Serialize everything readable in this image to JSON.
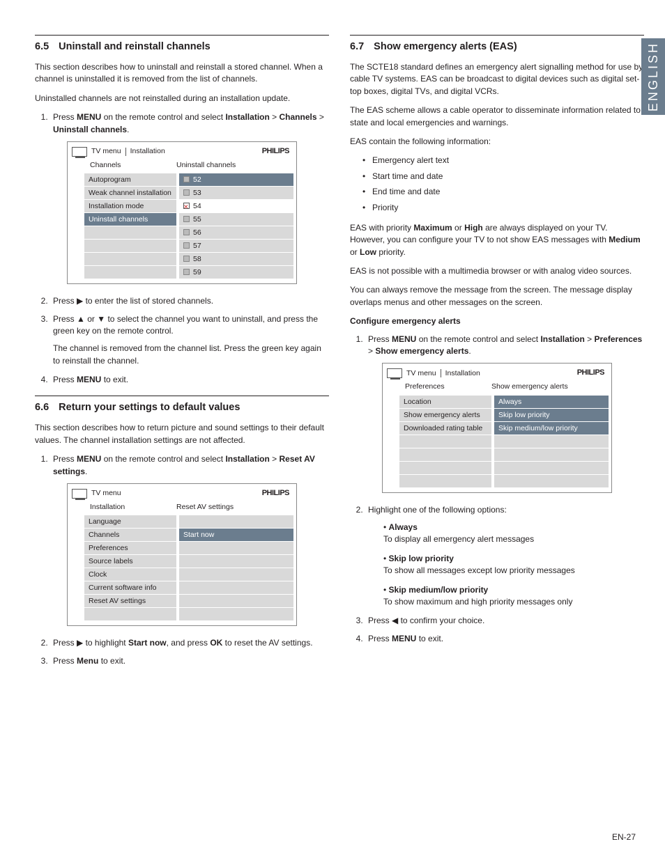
{
  "language_tab": "ENGLISH",
  "page_number": "EN-27",
  "brand": "PHILIPS",
  "left": {
    "s65": {
      "num": "6.5",
      "title": "Uninstall and reinstall channels",
      "p1": "This section describes how to uninstall and reinstall a stored channel. When a channel is uninstalled it is removed from the list of channels.",
      "p2": "Uninstalled channels are not reinstalled during an installation update.",
      "step1a": "Press ",
      "step1b": " on the remote control and select ",
      "step1c": " > ",
      "step1d": " > ",
      "step1e": ".",
      "menu": "MENU",
      "path1": "Installation",
      "path2": "Channels",
      "path3": "Uninstall channels",
      "tv": {
        "crumb1": "TV menu",
        "crumb2": "Installation",
        "sub_left": "Channels",
        "sub_right": "Uninstall channels",
        "left_rows": [
          "Autoprogram",
          "Weak channel installation",
          "Installation mode",
          "Uninstall channels"
        ],
        "left_selected": 3,
        "right_rows": [
          "52",
          "53",
          "54",
          "55",
          "56",
          "57",
          "58",
          "59"
        ],
        "right_selected": 0,
        "unchecked_index": 2
      },
      "step2a": "Press ",
      "step2b": " to enter the list of stored channels.",
      "step3a": "Press ",
      "step3b": " or ",
      "step3c": " to select the channel you want to uninstall, and press the green key on the remote control.",
      "step3_p2": "The channel is removed from the channel list. Press the green key again to reinstall the channel.",
      "step4a": "Press ",
      "step4b": " to exit."
    },
    "s66": {
      "num": "6.6",
      "title": "Return your settings to default values",
      "p1": "This section describes how to return picture and sound settings to their default values.  The channel installation settings are not affected.",
      "step1a": "Press ",
      "step1b": " on the remote control and select ",
      "step1c": " > ",
      "step1d": ".",
      "menu": "MENU",
      "path1": "Installation",
      "path2": "Reset AV settings",
      "tv": {
        "crumb1": "TV menu",
        "sub_left": "Installation",
        "sub_right": "Reset AV settings",
        "left_rows": [
          "Language",
          "Channels",
          "Preferences",
          "Source labels",
          "Clock",
          "Current software info",
          "Reset AV settings",
          ""
        ],
        "right_rows": [
          "",
          "Start now",
          "",
          "",
          "",
          "",
          "",
          ""
        ],
        "right_selected": 1
      },
      "step2a": "Press ",
      "step2b": " to highlight ",
      "step2c": ", and press ",
      "step2d": " to reset the AV settings.",
      "startnow": "Start now",
      "ok": "OK",
      "step3a": "Press ",
      "step3b": " to exit.",
      "menu3": "Menu"
    }
  },
  "right": {
    "s67": {
      "num": "6.7",
      "title": "Show emergency alerts (EAS)",
      "p1": "The SCTE18 standard defines an emergency alert signalling method for use by cable TV systems.  EAS can be broadcast to digital devices such as digital set-top boxes, digital TVs, and digital VCRs.",
      "p2": "The EAS scheme allows a cable operator to disseminate information related to state and local emergencies and warnings.",
      "p3": "EAS contain the following information:",
      "bullets": [
        "Emergency alert text",
        "Start time and date",
        "End time and date",
        "Priority"
      ],
      "p4a": "EAS with priority ",
      "p4b": " or ",
      "p4c": " are always displayed on your TV. However, you can configure your TV to not show EAS messages with ",
      "p4d": " or ",
      "p4e": " priority.",
      "max": "Maximum",
      "high": "High",
      "med": "Medium",
      "low": "Low",
      "p5": "EAS is not possible with a multimedia browser or with analog video sources.",
      "p6": "You can always remove the message from the screen.  The message display overlaps menus and other messages on the screen.",
      "config_head": "Configure emergency alerts",
      "step1a": "Press ",
      "step1b": " on the remote control and select ",
      "step1c": " > ",
      "step1d": " > ",
      "step1e": ".",
      "menu": "MENU",
      "path1": "Installation",
      "path2": "Preferences",
      "path3": "Show emergency alerts",
      "tv": {
        "crumb1": "TV menu",
        "crumb2": "Installation",
        "sub_left": "Preferences",
        "sub_right": "Show emergency alerts",
        "left_rows": [
          "Location",
          "Show emergency alerts",
          "Downloaded rating table",
          "",
          "",
          "",
          ""
        ],
        "right_rows": [
          "Always",
          "Skip low priority",
          "Skip medium/low priority",
          "",
          "",
          "",
          ""
        ]
      },
      "step2": "Highlight one of the following options:",
      "opts": [
        {
          "label": "Always",
          "desc": "To display all emergency alert messages"
        },
        {
          "label": "Skip low priority",
          "desc": "To show all messages except low priority messages"
        },
        {
          "label": "Skip medium/low priority",
          "desc": "To show maximum and high priority messages only"
        }
      ],
      "step3a": "Press ",
      "step3b": " to confirm your choice.",
      "step4a": "Press ",
      "step4b": " to exit."
    }
  }
}
